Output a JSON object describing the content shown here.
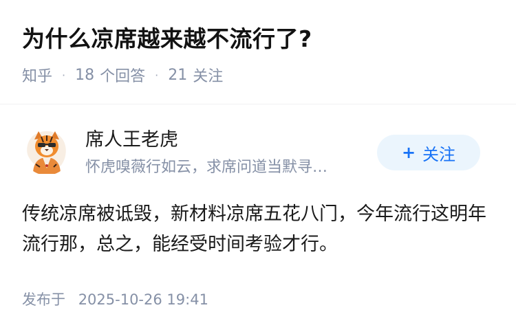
{
  "question": {
    "title": "为什么凉席越来越不流行了?",
    "source": "知乎",
    "answers_count": "18",
    "answers_label": "个回答",
    "followers_count": "21",
    "followers_label": "关注",
    "separator": "·"
  },
  "author": {
    "name": "席人王老虎",
    "bio": "怀虎嗅薇行如云，求席问道当默寻…",
    "avatar_icon": "tiger-avatar-icon"
  },
  "follow_button": {
    "plus": "+",
    "label": "关注"
  },
  "answer": {
    "text": "传统凉席被诋毁，新材料凉席五花八门，今年流行这明年流行那，总之，能经受时间考验才行。"
  },
  "publish": {
    "label": "发布于",
    "datetime": "2025-10-26 19:41"
  },
  "colors": {
    "title": "#121212",
    "meta": "#8590a6",
    "accent": "#1772f6",
    "button_bg": "#ebf5fd"
  }
}
